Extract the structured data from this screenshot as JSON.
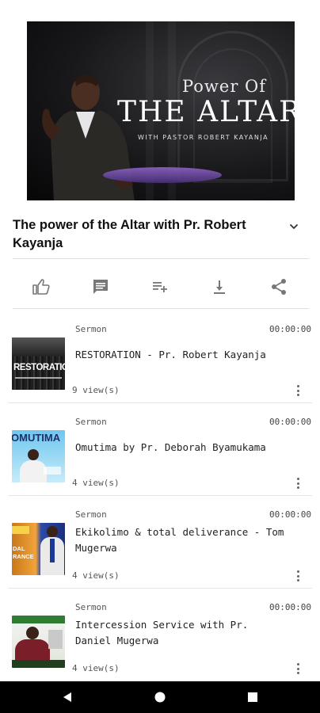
{
  "hero": {
    "title_small": "Power Of",
    "title_big": "The Altar",
    "subtitle": "WITH PASTOR ROBERT KAYANJA"
  },
  "video": {
    "title": "The power of the Altar with Pr. Robert Kayanja"
  },
  "actions": [
    "like-icon",
    "comment-icon",
    "playlist-add-icon",
    "download-icon",
    "share-icon"
  ],
  "items": [
    {
      "category": "Sermon",
      "duration": "00:00:00",
      "title": "RESTORATION - Pr. Robert Kayanja",
      "views": "9 view(s)",
      "thumb_text": "RESTORATION"
    },
    {
      "category": "Sermon",
      "duration": "00:00:00",
      "title": "Omutima by Pr. Deborah Byamukama",
      "views": "4 view(s)",
      "thumb_text": "OMUTIMA"
    },
    {
      "category": "Sermon",
      "duration": "00:00:00",
      "title": "Ekikolimo & total deliverance - Tom Mugerwa",
      "views": "4 view(s)",
      "thumb_text": "DAL RANCE"
    },
    {
      "category": "Sermon",
      "duration": "00:00:00",
      "title": "Intercession Service with Pr. Daniel Mugerwa",
      "views": "4 view(s)",
      "thumb_text": ""
    }
  ],
  "navbar": [
    "back-icon",
    "home-icon",
    "recents-icon"
  ]
}
